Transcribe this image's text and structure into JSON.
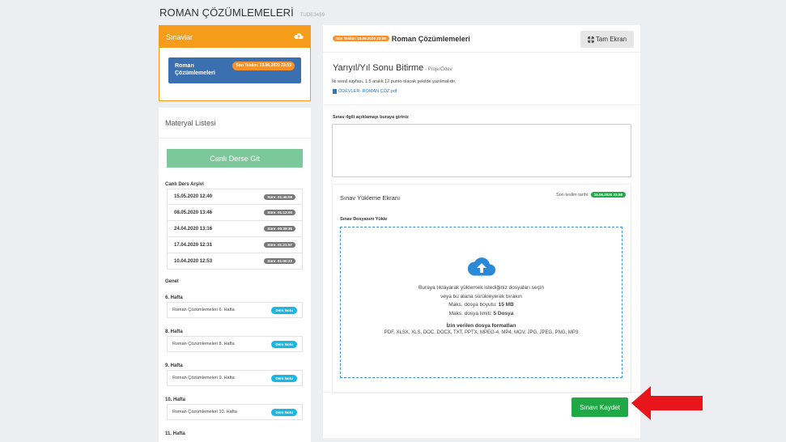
{
  "course": {
    "title": "ROMAN ÇÖZÜMLEMELERİ",
    "code": "TUDE3459"
  },
  "exams_panel": {
    "title": "Sınavlar",
    "icon": "cloud-upload-icon",
    "item": {
      "name": "Roman Çözümlemeleri",
      "deadline": "Son Teslim: 15.06.2020 23:59"
    }
  },
  "materials": {
    "title": "Materyal Listesi",
    "live_button": "Canlı Derse Git",
    "archive_title": "Canlı Ders Arşivi",
    "archive": [
      {
        "date": "15.05.2020 12:40",
        "duration": "Süre: 01:45:06"
      },
      {
        "date": "08.05.2020 13:46",
        "duration": "Süre: 01:12:00"
      },
      {
        "date": "24.04.2020 13:16",
        "duration": "Süre: 00:39:35"
      },
      {
        "date": "17.04.2020 12:31",
        "duration": "Süre: 01:21:57"
      },
      {
        "date": "10.04.2020 12:53",
        "duration": "Süre: 01:00:22"
      }
    ],
    "general_title": "Genel",
    "weeks": [
      {
        "title": "6. Hafta",
        "item": "Roman Çözümlemeleri 6. Hafta",
        "note": "Ders Notu"
      },
      {
        "title": "8. Hafta",
        "item": "Roman Çözümlemeleri 8. Hafta",
        "note": "Ders Notu"
      },
      {
        "title": "9. Hafta",
        "item": "Roman Çözümlemeleri 9. Hafta",
        "note": "Ders Notu"
      },
      {
        "title": "10. Hafta",
        "item": "Roman Çözümlemeleri 10. Hafta",
        "note": "Ders Notu"
      },
      {
        "title": "11. Hafta",
        "item": "",
        "note": ""
      }
    ]
  },
  "exam": {
    "deadline_badge": "Son Teslim: 15.06.2020 23:59",
    "name": "Roman Çözümlemeleri",
    "fullscreen_label": "Tam Ekran",
    "task_title": "Yarıyıl/Yıl Sonu Bitirme",
    "task_type": " - Proje/Ödev",
    "description": "İki word sayfası, 1.5 aralık 12 punto olacak şekilde yazılmalıdır.",
    "file_name": "ÖDEVLER- ROMAN ÇÖZ.pdf",
    "explanation_label": "Sınav ilgili açıklamayı buraya giriniz",
    "explanation_value": ""
  },
  "upload": {
    "title": "Sınav Yükleme Ekranı",
    "deadline_label": "Son teslim tarihi:",
    "deadline_value": "15.06.2020 23:59",
    "file_label": "Sınav Dosyasını Yükle",
    "line1": "Buraya tıklayarak yüklemek istediğiniz dosyaları seçin",
    "line2": "veya bu alana sürükleyerek bırakın",
    "max_size_label": "Maks. dosya boyutu: ",
    "max_size_value": "15 MB",
    "max_count_label": "Maks. dosya limiti: ",
    "max_count_value": "5 Dosya",
    "formats_title": "İzin verilen dosya formatları",
    "formats": "PDF, XLSX, XLS, DOC, DOCX, TXT, PPTX, MPEG-4, MP4, MOV, JPG, JPEG, PNG, MP3"
  },
  "save_button": "Sınavı Kaydet",
  "colors": {
    "orange": "#f59c1a",
    "blue": "#3a6fb0",
    "green": "#1fa845",
    "arrow": "#e8151b"
  }
}
